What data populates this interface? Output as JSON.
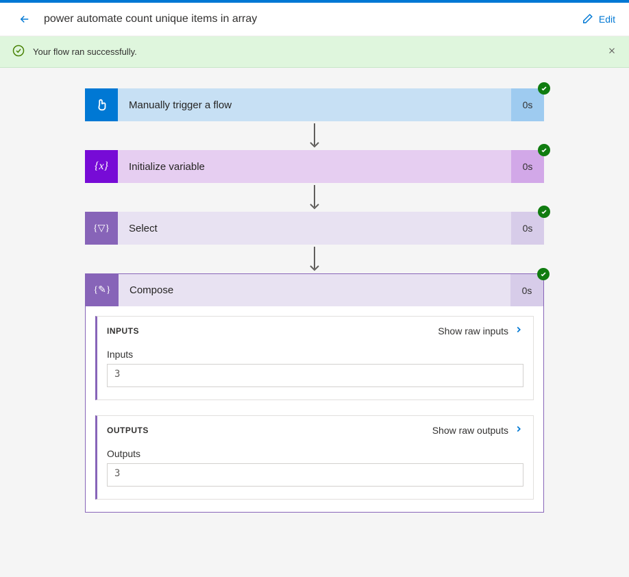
{
  "header": {
    "title": "power automate count unique items in array",
    "edit_label": "Edit"
  },
  "success": {
    "message": "Your flow ran successfully."
  },
  "steps": {
    "trigger": {
      "label": "Manually trigger a flow",
      "time": "0s"
    },
    "init": {
      "label": "Initialize variable",
      "time": "0s"
    },
    "select": {
      "label": "Select",
      "time": "0s"
    },
    "compose": {
      "label": "Compose",
      "time": "0s"
    }
  },
  "compose_panel": {
    "inputs": {
      "title": "INPUTS",
      "show_raw_label": "Show raw inputs",
      "field_label": "Inputs",
      "value": "3"
    },
    "outputs": {
      "title": "OUTPUTS",
      "show_raw_label": "Show raw outputs",
      "field_label": "Outputs",
      "value": "3"
    }
  }
}
